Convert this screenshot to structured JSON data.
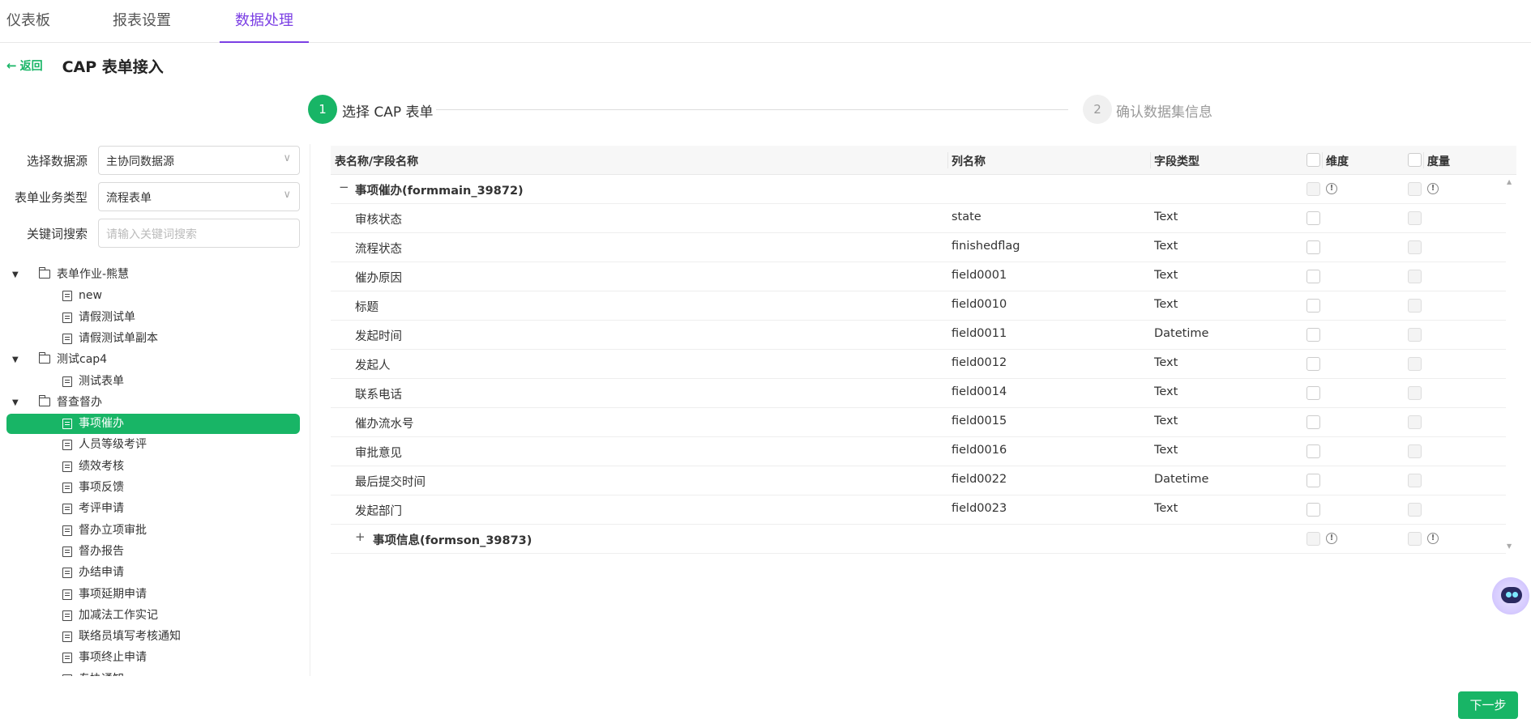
{
  "nav": {
    "tabs": [
      {
        "label": "仪表板"
      },
      {
        "label": "报表设置"
      },
      {
        "label": "数据处理"
      }
    ]
  },
  "header": {
    "back_label": "返回",
    "title": "CAP 表单接入"
  },
  "steps": [
    {
      "num": "1",
      "label": "选择 CAP 表单"
    },
    {
      "num": "2",
      "label": "确认数据集信息"
    }
  ],
  "filters": {
    "datasource_label": "选择数据源",
    "datasource_value": "主协同数据源",
    "biztype_label": "表单业务类型",
    "biztype_value": "流程表单",
    "keyword_label": "关键词搜索",
    "keyword_placeholder": "请输入关键词搜索"
  },
  "tree": [
    {
      "type": "folder",
      "label": "表单作业-熊慧"
    },
    {
      "type": "doc",
      "label": "new"
    },
    {
      "type": "doc",
      "label": "请假测试单"
    },
    {
      "type": "doc",
      "label": "请假测试单副本"
    },
    {
      "type": "folder",
      "label": "测试cap4"
    },
    {
      "type": "doc",
      "label": "测试表单"
    },
    {
      "type": "folder",
      "label": "督查督办"
    },
    {
      "type": "doc",
      "label": "事项催办",
      "selected": true
    },
    {
      "type": "doc",
      "label": "人员等级考评"
    },
    {
      "type": "doc",
      "label": "绩效考核"
    },
    {
      "type": "doc",
      "label": "事项反馈"
    },
    {
      "type": "doc",
      "label": "考评申请"
    },
    {
      "type": "doc",
      "label": "督办立项审批"
    },
    {
      "type": "doc",
      "label": "督办报告"
    },
    {
      "type": "doc",
      "label": "办结申请"
    },
    {
      "type": "doc",
      "label": "事项延期申请"
    },
    {
      "type": "doc",
      "label": "加减法工作实记"
    },
    {
      "type": "doc",
      "label": "联络员填写考核通知"
    },
    {
      "type": "doc",
      "label": "事项终止申请"
    },
    {
      "type": "doc",
      "label": "专协通知"
    }
  ],
  "table": {
    "headers": {
      "name": "表名称/字段名称",
      "column": "列名称",
      "type": "字段类型",
      "dimension": "维度",
      "measure": "度量"
    },
    "group1": {
      "expander": "−",
      "name": "事项催办(formmain_39872)"
    },
    "rows": [
      {
        "name": "审核状态",
        "column": "state",
        "type": "Text"
      },
      {
        "name": "流程状态",
        "column": "finishedflag",
        "type": "Text"
      },
      {
        "name": "催办原因",
        "column": "field0001",
        "type": "Text"
      },
      {
        "name": "标题",
        "column": "field0010",
        "type": "Text"
      },
      {
        "name": "发起时间",
        "column": "field0011",
        "type": "Datetime"
      },
      {
        "name": "发起人",
        "column": "field0012",
        "type": "Text"
      },
      {
        "name": "联系电话",
        "column": "field0014",
        "type": "Text"
      },
      {
        "name": "催办流水号",
        "column": "field0015",
        "type": "Text"
      },
      {
        "name": "审批意见",
        "column": "field0016",
        "type": "Text"
      },
      {
        "name": "最后提交时间",
        "column": "field0022",
        "type": "Datetime"
      },
      {
        "name": "发起部门",
        "column": "field0023",
        "type": "Text"
      }
    ],
    "group2": {
      "expander": "+",
      "name": "事项信息(formson_39873)"
    }
  },
  "footer": {
    "next_label": "下一步"
  },
  "icons": {
    "info": "!",
    "tri": "▼",
    "chev": "∨",
    "arrow": "←"
  },
  "colors": {
    "primary": "#18b566",
    "nav_active": "#7b3fe4"
  }
}
